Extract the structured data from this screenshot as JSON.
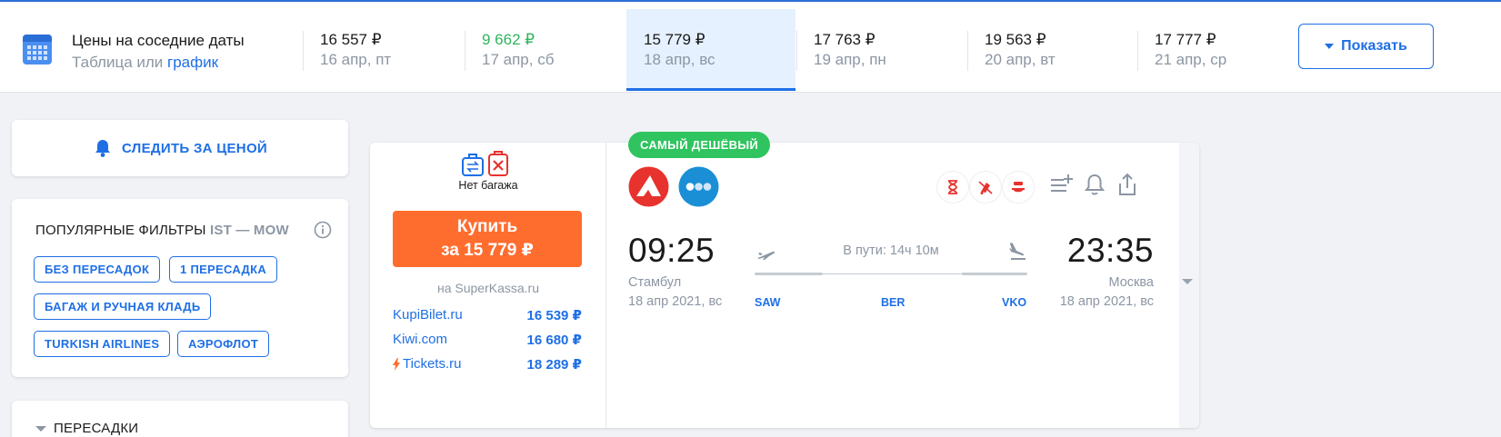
{
  "header": {
    "title": "Цены на соседние даты",
    "sub_table": "Таблица",
    "sub_or": " или ",
    "sub_graph": "график",
    "show_button": "Показать",
    "dates": [
      {
        "price": "16 557 ₽",
        "day": "16 апр, пт",
        "state": "normal"
      },
      {
        "price": "9 662 ₽",
        "day": "17 апр, сб",
        "state": "cheapest"
      },
      {
        "price": "15 779 ₽",
        "day": "18 апр, вс",
        "state": "selected"
      },
      {
        "price": "17 763 ₽",
        "day": "19 апр, пн",
        "state": "normal"
      },
      {
        "price": "19 563 ₽",
        "day": "20 апр, вт",
        "state": "normal"
      },
      {
        "price": "17 777 ₽",
        "day": "21 апр, ср",
        "state": "normal"
      }
    ]
  },
  "sidebar": {
    "watch_price": "СЛЕДИТЬ ЗА ЦЕНОЙ",
    "popular_filters": "ПОПУЛЯРНЫЕ ФИЛЬТРЫ",
    "route": "IST — MOW",
    "chips": [
      "БЕЗ ПЕРЕСАДОК",
      "1 ПЕРЕСАДКА",
      "БАГАЖ И РУЧНАЯ КЛАДЬ",
      "TURKISH AIRLINES",
      "АЭРОФЛОТ"
    ],
    "transfers": "ПЕРЕСАДКИ"
  },
  "ticket": {
    "baggage": "Нет багажа",
    "buy_line1": "Купить",
    "buy_line2": "за 15 779 ₽",
    "via": "на SuperKassa.ru",
    "offers": [
      {
        "name": "KupiBilet.ru",
        "price": "16 539 ₽"
      },
      {
        "name": "Kiwi.com",
        "price": "16 680 ₽"
      },
      {
        "name": "Tickets.ru",
        "price": "18 289 ₽"
      }
    ],
    "badge": "САМЫЙ ДЕШЁВЫЙ",
    "departure": {
      "time": "09:25",
      "city": "Стамбул",
      "date": "18 апр 2021, вс",
      "code": "SAW"
    },
    "arrival": {
      "time": "23:35",
      "city": "Москва",
      "date": "18 апр 2021, вс",
      "code": "VKO"
    },
    "transfer_code": "BER",
    "duration": "В пути: 14ч 10м"
  },
  "colors": {
    "accent": "#1e6fe6",
    "buy": "#ff6d2e",
    "cheapest": "#2fb55e",
    "badge": "#2fc45f",
    "pobeda_red": "#e8322d",
    "airline_blue": "#1b8fd6"
  }
}
